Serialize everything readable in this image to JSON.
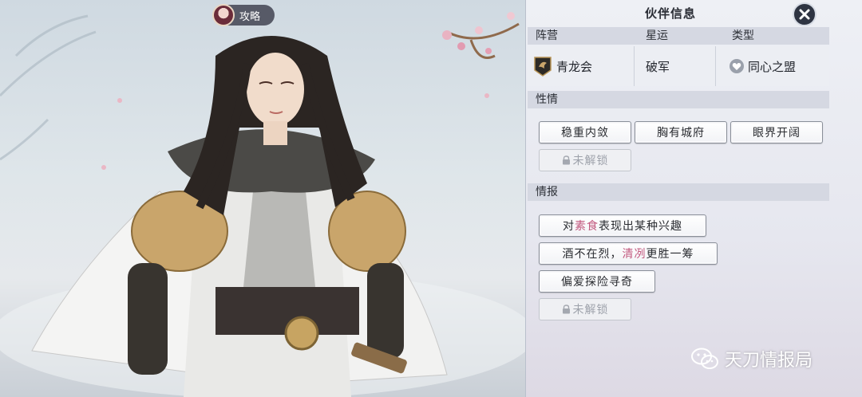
{
  "guide_badge": {
    "label": "攻略"
  },
  "panel": {
    "title": "伙伴信息",
    "header": {
      "camp": "阵营",
      "star": "星运",
      "type": "类型"
    },
    "values": {
      "camp": "青龙会",
      "star": "破军",
      "type": "同心之盟"
    },
    "personality": {
      "heading": "性情",
      "tags": [
        "稳重内敛",
        "胸有城府",
        "眼界开阔"
      ],
      "locked": "未解锁"
    },
    "intel": {
      "heading": "情报",
      "items": [
        {
          "pre": "对",
          "hl": "素食",
          "post": "表现出某种兴趣"
        },
        {
          "pre": "酒不在烈，",
          "hl": "清冽",
          "post": "更胜一筹"
        },
        {
          "pre": "偏爱探险寻奇",
          "hl": "",
          "post": ""
        }
      ],
      "locked": "未解锁"
    }
  },
  "watermark": {
    "text": "天刀情报局"
  },
  "colors": {
    "highlight": "#c2587e",
    "panel_bar": "#d5d8e2",
    "close_bg": "#2e3442"
  }
}
